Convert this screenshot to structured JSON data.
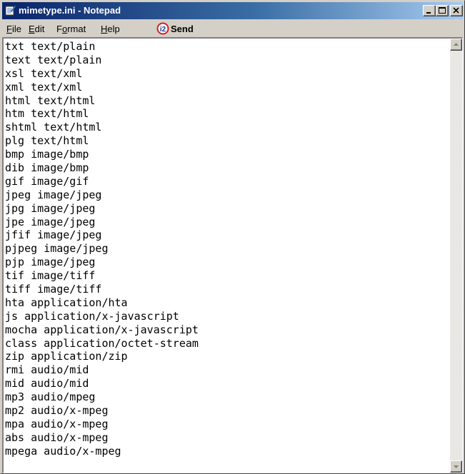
{
  "window": {
    "title": "mimetype.ini - Notepad"
  },
  "menu": {
    "items": [
      {
        "first": "F",
        "rest": "ile"
      },
      {
        "first": "E",
        "rest": "dit"
      },
      {
        "pre": "F",
        "underline": "o",
        "rest": "rmat"
      },
      {
        "first": "H",
        "rest": "elp"
      }
    ],
    "send_label": "Send"
  },
  "editor": {
    "lines": [
      "txt text/plain",
      "text text/plain",
      "xsl text/xml",
      "xml text/xml",
      "html text/html",
      "htm text/html",
      "shtml text/html",
      "plg text/html",
      "bmp image/bmp",
      "dib image/bmp",
      "gif image/gif",
      "jpeg image/jpeg",
      "jpg image/jpeg",
      "jpe image/jpeg",
      "jfif image/jpeg",
      "pjpeg image/jpeg",
      "pjp image/jpeg",
      "tif image/tiff",
      "tiff image/tiff",
      "hta application/hta",
      "js application/x-javascript",
      "mocha application/x-javascript",
      "class application/octet-stream",
      "zip application/zip",
      "rmi audio/mid",
      "mid audio/mid",
      "mp3 audio/mpeg",
      "mp2 audio/x-mpeg",
      "mpa audio/x-mpeg",
      "abs audio/x-mpeg",
      "mpega audio/x-mpeg"
    ]
  },
  "icons": {
    "app": "notepad-icon",
    "send": "i2-send-icon",
    "minimize": "minimize-icon",
    "maximize": "maximize-icon",
    "close": "close-icon",
    "scroll_up": "scroll-up-arrow-icon",
    "scroll_down": "scroll-down-arrow-icon"
  },
  "colors": {
    "titlebar_start": "#0a246a",
    "titlebar_end": "#a6caf0",
    "face": "#d4d0c8",
    "send_icon_red": "#d42020"
  }
}
